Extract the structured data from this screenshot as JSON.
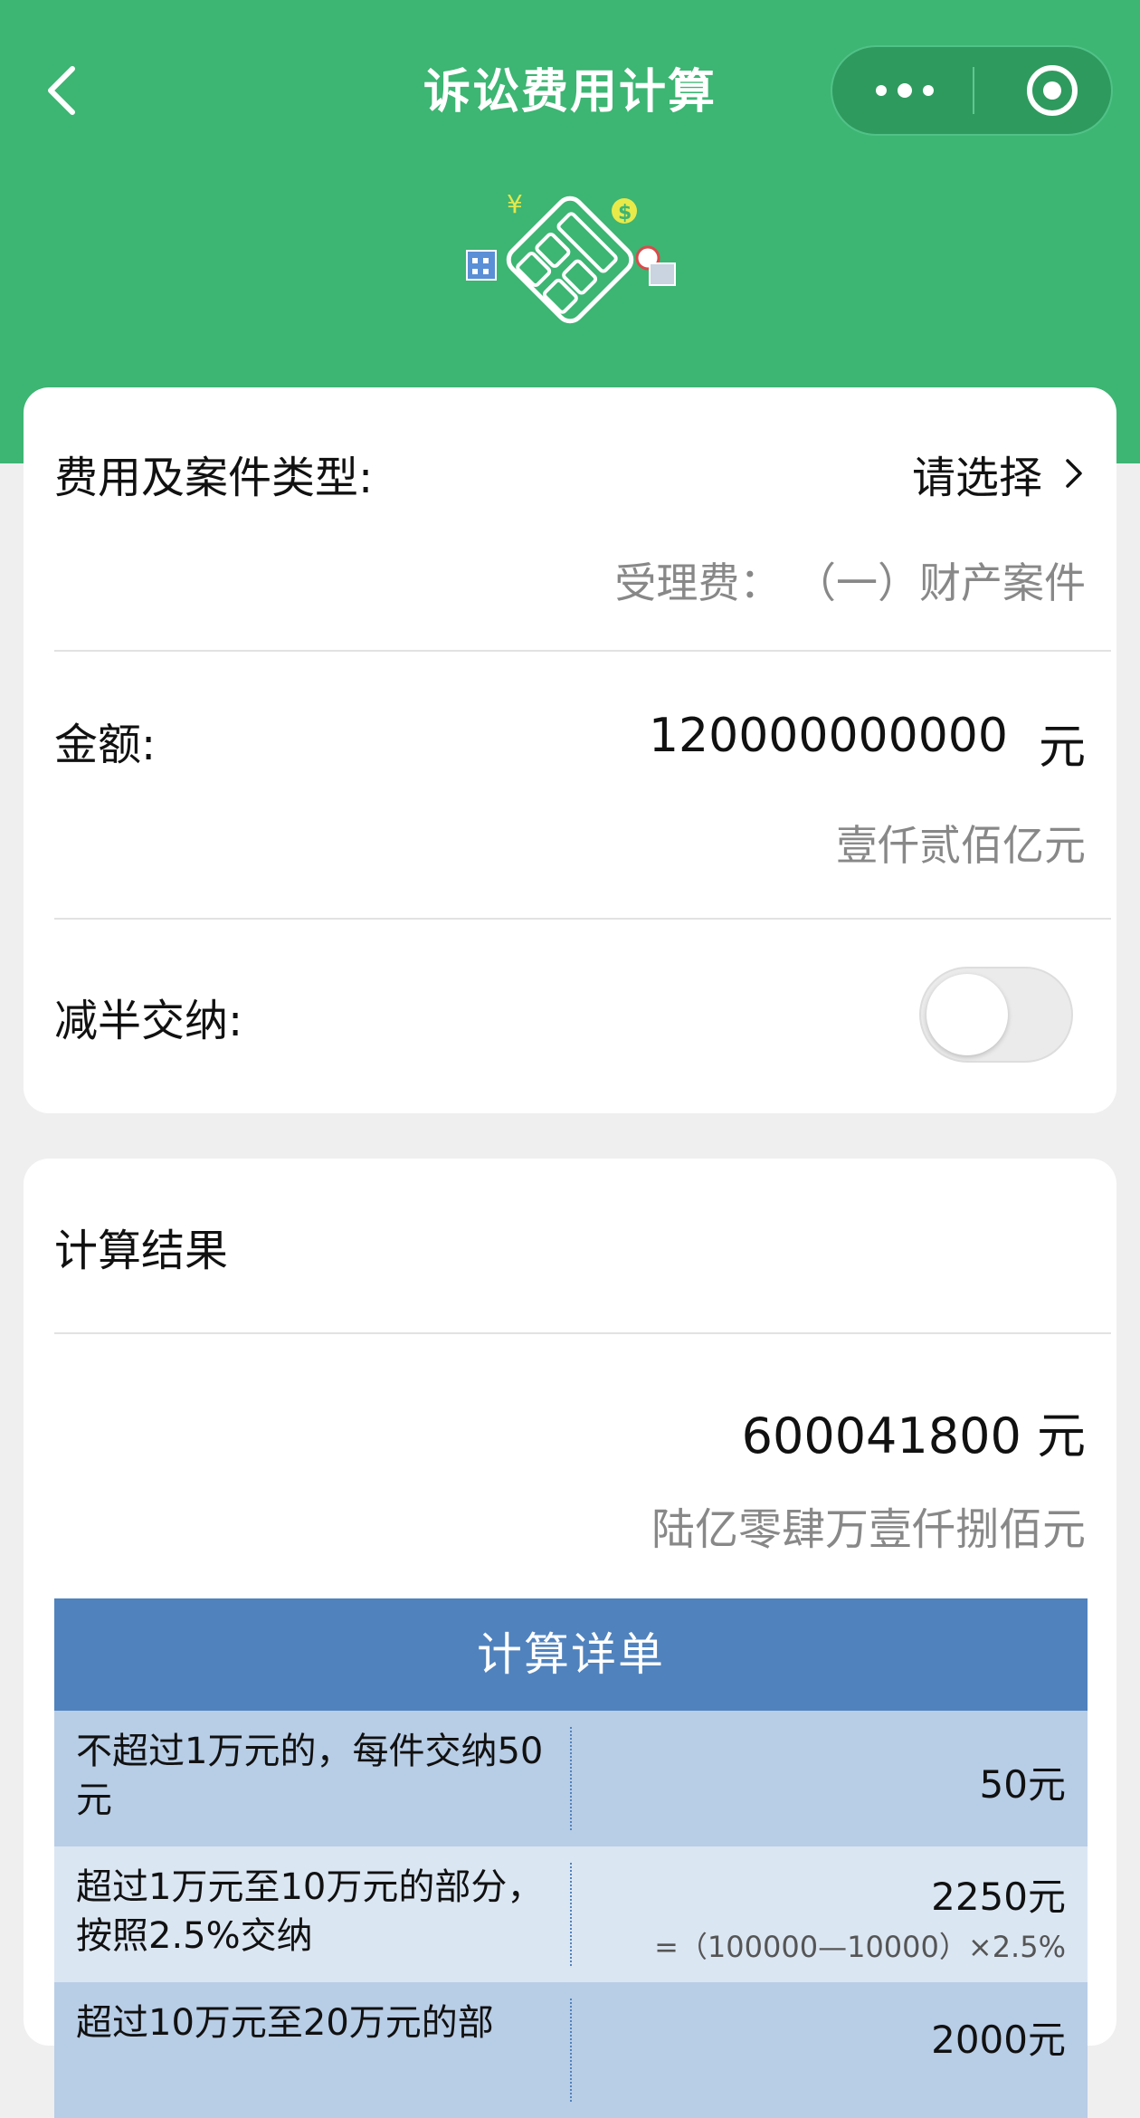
{
  "nav": {
    "title": "诉讼费用计算",
    "back_icon": "chevron-left-icon",
    "more_icon": "more-dots-icon",
    "target_icon": "target-icon"
  },
  "form": {
    "type_label": "费用及案件类型:",
    "type_value": "请选择",
    "type_sub_prefix": "受理费：",
    "type_sub_value": "（一）财产案件",
    "amount_label": "金额:",
    "amount_value": "120000000000",
    "amount_unit": "元",
    "amount_chinese": "壹仟贰佰亿元",
    "half_label": "减半交纳:",
    "half_enabled": false
  },
  "result": {
    "title": "计算结果",
    "value": "600041800 元",
    "chinese": "陆亿零肆万壹仟捌佰元",
    "detail_title": "计算详单",
    "rows": [
      {
        "desc": "不超过1万元的，每件交纳50元",
        "amount": "50元",
        "formula": ""
      },
      {
        "desc": "超过1万元至10万元的部分，按照2.5%交纳",
        "amount": "2250元",
        "formula": "=（100000—10000）×2.5%"
      },
      {
        "desc": "超过10万元至20万元的部",
        "amount": "2000元",
        "formula": ""
      }
    ]
  },
  "colors": {
    "header": "#3db573",
    "table_head": "#5082bd",
    "row_dark": "#b8cde6",
    "row_light": "#dbe6f3"
  }
}
